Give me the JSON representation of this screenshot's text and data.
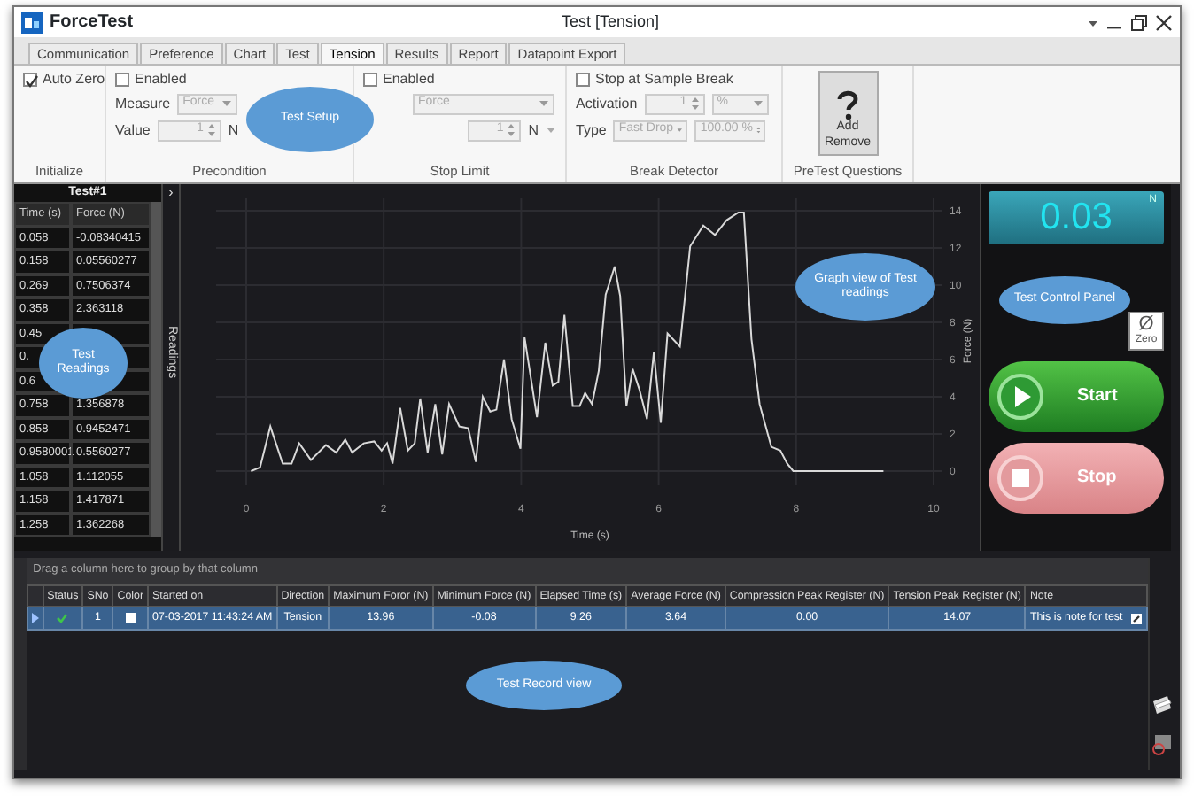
{
  "window": {
    "app_name": "ForceTest",
    "title": "Test [Tension]"
  },
  "tabs": [
    {
      "label": "Communication",
      "selected": false
    },
    {
      "label": "Preference",
      "selected": false
    },
    {
      "label": "Chart",
      "selected": false
    },
    {
      "label": "Test",
      "selected": false
    },
    {
      "label": "Tension",
      "selected": true
    },
    {
      "label": "Results",
      "selected": false
    },
    {
      "label": "Report",
      "selected": false
    },
    {
      "label": "Datapoint Export",
      "selected": false
    }
  ],
  "ribbon": {
    "callout": "Test Setup",
    "initialize": {
      "label": "Initialize",
      "auto_zero": {
        "label": "Auto Zero",
        "checked": true
      }
    },
    "precondition": {
      "label": "Precondition",
      "enabled": {
        "label": "Enabled",
        "checked": false
      },
      "measure": {
        "label": "Measure",
        "value": "Force",
        "disabled": true
      },
      "value": {
        "label": "Value",
        "value": "1",
        "disabled": true
      },
      "unit": "N"
    },
    "stop_limit": {
      "label": "Stop Limit",
      "enabled": {
        "label": "Enabled",
        "checked": false
      },
      "measure": {
        "value": "Force",
        "disabled": true
      },
      "value": {
        "value": "1",
        "disabled": true
      },
      "unit": "N"
    },
    "break_detector": {
      "label": "Break Detector",
      "stop_at_break": {
        "label": "Stop at Sample Break",
        "checked": false
      },
      "activation": {
        "label": "Activation",
        "value": "1",
        "unit": "%",
        "disabled": true
      },
      "type": {
        "label": "Type",
        "value": "Fast Drop",
        "threshold": "100.00 %",
        "disabled": true
      }
    },
    "pretest": {
      "label": "PreTest Questions",
      "button": {
        "line_1": "Add",
        "line_2": "Remove"
      }
    }
  },
  "readings": {
    "title": "Test#1",
    "expand_symbol": "›",
    "columns": [
      "Time (s)",
      "Force (N)"
    ],
    "tab_label": "Readings",
    "callout": "Test Readings",
    "rows": [
      {
        "time": "0.058",
        "force": "-0.08340415"
      },
      {
        "time": "0.158",
        "force": "0.05560277"
      },
      {
        "time": "0.269",
        "force": "0.7506374"
      },
      {
        "time": "0.358",
        "force": "2.363118"
      },
      {
        "time": "0.45"
      },
      {
        "time": "0."
      },
      {
        "time": "0.6"
      },
      {
        "time": "0.758",
        "force": "1.356878"
      },
      {
        "time": "0.858",
        "force": "0.9452471"
      },
      {
        "time": "0.9580001",
        "force": "0.5560277"
      },
      {
        "time": "1.058",
        "force": "1.112055"
      },
      {
        "time": "1.158",
        "force": "1.417871"
      },
      {
        "time": "1.258",
        "force": "1.362268"
      }
    ]
  },
  "graph": {
    "callout": "Graph view of Test readings",
    "chart_data": {
      "type": "line",
      "grid": true,
      "xlabel": "Time (s)",
      "ylabel": "Force (N)",
      "xlim": [
        0,
        10
      ],
      "ylim": [
        0,
        14
      ],
      "xticks": [
        0,
        2,
        4,
        6,
        8,
        10
      ],
      "yticks": [
        0,
        2,
        4,
        6,
        8,
        10,
        12,
        14
      ],
      "x": [
        0.07,
        0.2,
        0.35,
        0.53,
        0.66,
        0.77,
        0.94,
        1.16,
        1.31,
        1.44,
        1.54,
        1.71,
        1.86,
        1.97,
        2.05,
        2.13,
        2.24,
        2.35,
        2.45,
        2.53,
        2.64,
        2.75,
        2.85,
        2.95,
        3.1,
        3.23,
        3.34,
        3.44,
        3.55,
        3.64,
        3.75,
        3.86,
        3.99,
        4.05,
        4.23,
        4.35,
        4.46,
        4.54,
        4.63,
        4.75,
        4.85,
        4.93,
        5.03,
        5.13,
        5.23,
        5.36,
        5.44,
        5.53,
        5.62,
        5.72,
        5.83,
        5.93,
        6.03,
        6.13,
        6.31,
        6.46,
        6.65,
        6.82,
        6.99,
        7.16,
        7.24,
        7.35,
        7.47,
        7.64,
        7.77,
        7.87,
        7.96,
        9.27
      ],
      "series": [
        {
          "color": "#d9d9d9",
          "values": [
            0,
            0.2,
            2.4,
            0.4,
            0.4,
            1.5,
            0.6,
            1.4,
            1.0,
            1.7,
            1.0,
            1.5,
            1.6,
            1.1,
            1.5,
            0.4,
            3.4,
            1.1,
            1.5,
            3.9,
            1.0,
            3.6,
            0.9,
            3.6,
            2.4,
            2.3,
            0.5,
            4.0,
            3.2,
            3.3,
            6.0,
            2.8,
            1.2,
            7.2,
            2.9,
            6.9,
            4.6,
            4.8,
            8.4,
            3.5,
            3.5,
            4.2,
            3.6,
            5.4,
            9.5,
            11.0,
            9.4,
            3.5,
            5.5,
            4.4,
            2.8,
            6.4,
            2.6,
            7.4,
            6.7,
            12.1,
            13.2,
            12.7,
            13.5,
            13.9,
            13.9,
            7.1,
            3.6,
            1.3,
            1.1,
            0.4,
            0,
            0
          ]
        }
      ]
    }
  },
  "control_panel": {
    "reading": "0.03",
    "unit": "N",
    "callout": "Test Control Panel",
    "zero": {
      "symbol": "Ø",
      "label": "Zero"
    },
    "start": "Start",
    "stop": "Stop"
  },
  "records": {
    "group_hint": "Drag a column here to group by that column",
    "callout": "Test Record view",
    "columns": [
      "Status",
      "SNo",
      "Color",
      "Started on",
      "Direction",
      "Maximum Foror (N)",
      "Minimum Force (N)",
      "Elapsed Time (s)",
      "Average Force (N)",
      "Compression Peak Register (N)",
      "Tension Peak Register (N)",
      "Note"
    ],
    "rows": [
      {
        "selected": true,
        "sno": "1",
        "color": "#ffffff",
        "started_on": "07-03-2017 11:43:24 AM",
        "direction": "Tension",
        "max_force": "13.96",
        "min_force": "-0.08",
        "elapsed": "9.26",
        "avg_force": "3.64",
        "compression_peak": "0.00",
        "tension_peak": "14.07",
        "note": "This is note for test"
      }
    ]
  }
}
